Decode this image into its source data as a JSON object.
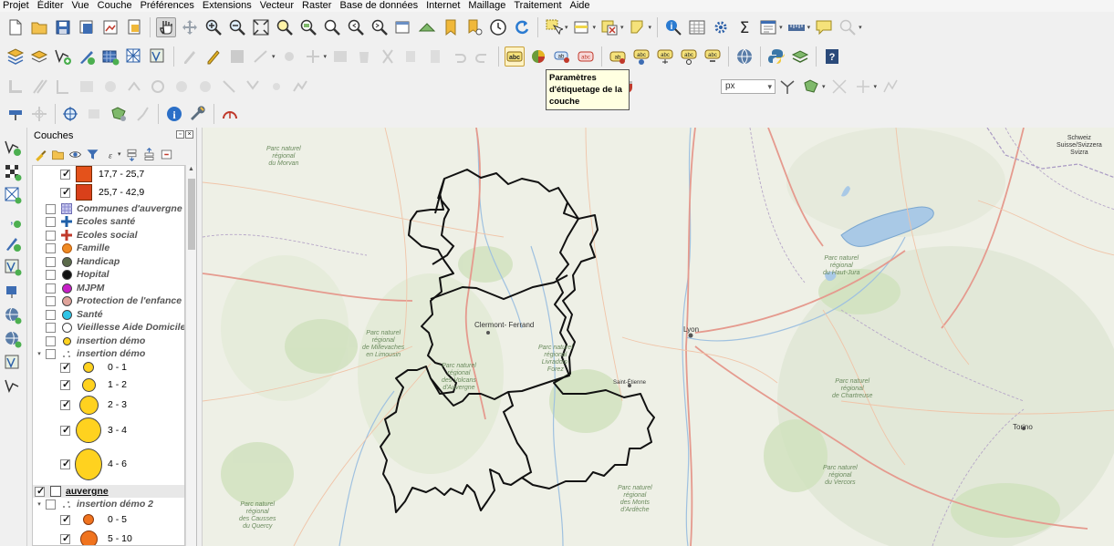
{
  "menu": [
    "Projet",
    "Éditer",
    "Vue",
    "Couche",
    "Préférences",
    "Extensions",
    "Vecteur",
    "Raster",
    "Base de données",
    "Internet",
    "Maillage",
    "Traitement",
    "Aide"
  ],
  "tooltip": {
    "text": "Paramètres d'étiquetage de la couche"
  },
  "label_toolbar": {
    "unit_value": "px"
  },
  "layers_panel": {
    "title": "Couches",
    "items": [
      {
        "label": "17,7 - 25,7",
        "checked": true,
        "symbol": "square",
        "color": "#e4521b"
      },
      {
        "label": "25,7 - 42,9",
        "checked": true,
        "symbol": "square",
        "color": "#d9401a"
      },
      {
        "label": "Communes d'auvergne",
        "checked": false,
        "symbol": "hatch",
        "color": "#9b9bcf"
      },
      {
        "label": "Ecoles santé",
        "checked": false,
        "symbol": "cross",
        "color": "#1f5fa8"
      },
      {
        "label": "Ecoles social",
        "checked": false,
        "symbol": "cross",
        "color": "#c0392b"
      },
      {
        "label": "Famille",
        "checked": false,
        "symbol": "dot",
        "color": "#f08a24"
      },
      {
        "label": "Handicap",
        "checked": false,
        "symbol": "dot",
        "color": "#5b6b4b"
      },
      {
        "label": "Hopital",
        "checked": false,
        "symbol": "dot",
        "color": "#111111"
      },
      {
        "label": "MJPM",
        "checked": false,
        "symbol": "dot",
        "color": "#c81fc8"
      },
      {
        "label": "Protection de l'enfance",
        "checked": false,
        "symbol": "dot",
        "color": "#e0a39a"
      },
      {
        "label": "Santé",
        "checked": false,
        "symbol": "dot",
        "color": "#2ec4e6"
      },
      {
        "label": "Vieillesse Aide Domicile",
        "checked": false,
        "symbol": "dot",
        "color": "#ffffff"
      },
      {
        "label": "insertion démo",
        "checked": false,
        "symbol": "dot",
        "color": "#ffd21f"
      },
      {
        "label": "insertion démo",
        "checked": false,
        "symbol": "group",
        "color": ""
      },
      {
        "label": "0 - 1",
        "checked": true,
        "symbol": "circle",
        "color": "#ffd21f"
      },
      {
        "label": "1 - 2",
        "checked": true,
        "symbol": "circle",
        "color": "#ffd21f"
      },
      {
        "label": "2 - 3",
        "checked": true,
        "symbol": "circle",
        "color": "#ffd21f"
      },
      {
        "label": "3 - 4",
        "checked": true,
        "symbol": "circle",
        "color": "#ffd21f"
      },
      {
        "label": "4 - 6",
        "checked": true,
        "symbol": "circle",
        "color": "#ffd21f"
      },
      {
        "label": "auvergne",
        "checked": true,
        "symbol": "outline",
        "color": "#ffffff"
      },
      {
        "label": "insertion démo 2",
        "checked": false,
        "symbol": "group",
        "color": ""
      },
      {
        "label": "0 - 5",
        "checked": true,
        "symbol": "circle",
        "color": "#f0731e"
      },
      {
        "label": "5 - 10",
        "checked": true,
        "symbol": "circle",
        "color": "#f0731e"
      }
    ]
  },
  "map": {
    "labels": [
      {
        "text": "Clermont-\nFerrand",
        "kind": "city"
      },
      {
        "text": "Lyon",
        "kind": "city"
      },
      {
        "text": "Saint-Étienne",
        "kind": "city"
      },
      {
        "text": "Torino",
        "kind": "city"
      },
      {
        "text": "Parc naturel\nrégional\nde Millevaches\nen Limousin",
        "kind": "park"
      },
      {
        "text": "Parc naturel\nrégional\ndes Volcans\nd'Auvergne",
        "kind": "park"
      },
      {
        "text": "Parc naturel\nrégional\nLivradois-\nForez",
        "kind": "park"
      },
      {
        "text": "Parc naturel\nrégional\ndes Monts\nd'Ardèche",
        "kind": "park"
      },
      {
        "text": "Parc naturel\nrégional\ndes Causses\ndu Quercy",
        "kind": "park"
      },
      {
        "text": "Parc naturel\nrégional\ndu Vercors",
        "kind": "park"
      },
      {
        "text": "Parc naturel\nrégional\nde Chartreuse",
        "kind": "park"
      },
      {
        "text": "Parc naturel\nrégional\ndu Haut-Jura",
        "kind": "park"
      },
      {
        "text": "Parc naturel\nrégional\ndu Morvan",
        "kind": "park"
      },
      {
        "text": "Schweiz\nSuisse/Svizzera\nSvizra",
        "kind": "city"
      }
    ]
  },
  "colors": {
    "region_outline": "#111111",
    "map_bg": "#eef0e6",
    "lake": "#a9c9e6",
    "tooltip_bg": "#ffffe1"
  }
}
